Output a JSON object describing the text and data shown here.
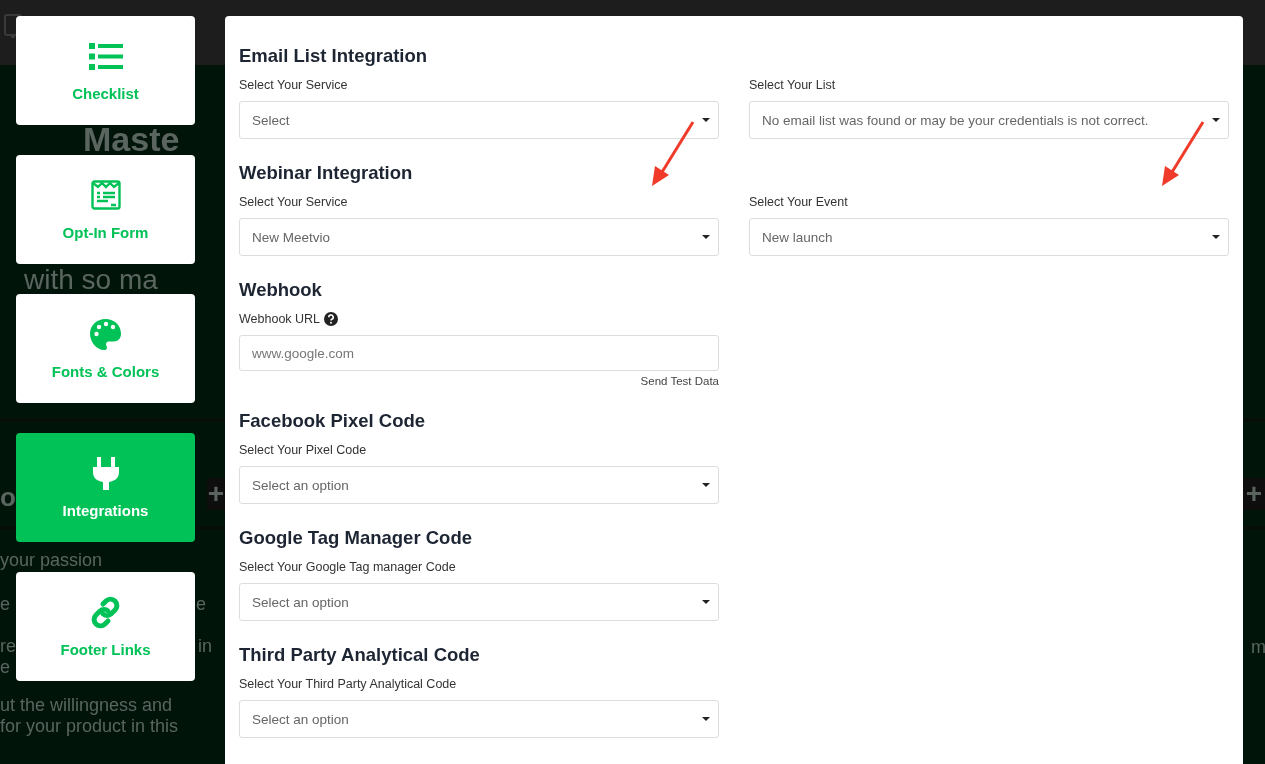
{
  "backdrop": {
    "texts": [
      "Maste",
      "with so ma",
      "o",
      "+",
      "+",
      "your passion",
      "e",
      "e",
      "re",
      "in",
      "e",
      "m",
      "ut the willingness and",
      "for your product in this"
    ]
  },
  "sidebar": {
    "items": [
      {
        "label": "Checklist",
        "kind": "list",
        "selected": false
      },
      {
        "label": "Opt-In Form",
        "kind": "form",
        "selected": false
      },
      {
        "label": "Fonts & Colors",
        "kind": "palette",
        "selected": false
      },
      {
        "label": "Integrations",
        "kind": "plug",
        "selected": true
      },
      {
        "label": "Footer Links",
        "kind": "link",
        "selected": false
      }
    ]
  },
  "modal": {
    "sections": [
      {
        "title": "Email List Integration",
        "fields": [
          {
            "label": "Select Your Service",
            "kind": "select",
            "value": "Select"
          },
          {
            "label": "Select Your List",
            "kind": "select",
            "value": "No email list was found or may be your credentials is not correct."
          }
        ]
      },
      {
        "title": "Webinar Integration",
        "fields": [
          {
            "label": "Select Your Service",
            "kind": "select",
            "value": "New Meetvio",
            "arrow": true
          },
          {
            "label": "Select Your Event",
            "kind": "select",
            "value": "New launch",
            "arrow": true
          }
        ]
      },
      {
        "title": "Webhook",
        "fields": [
          {
            "label": "Webhook URL",
            "kind": "input",
            "help": true,
            "placeholder": "www.google.com",
            "link": "Send Test Data"
          }
        ]
      },
      {
        "title": "Facebook Pixel Code",
        "fields": [
          {
            "label": "Select Your Pixel Code",
            "kind": "select",
            "value": "Select an option"
          }
        ]
      },
      {
        "title": "Google Tag Manager Code",
        "fields": [
          {
            "label": "Select Your Google Tag manager Code",
            "kind": "select",
            "value": "Select an option"
          }
        ]
      },
      {
        "title": "Third Party Analytical Code",
        "fields": [
          {
            "label": "Select Your Third Party Analytical Code",
            "kind": "select",
            "value": "Select an option"
          }
        ]
      }
    ]
  }
}
